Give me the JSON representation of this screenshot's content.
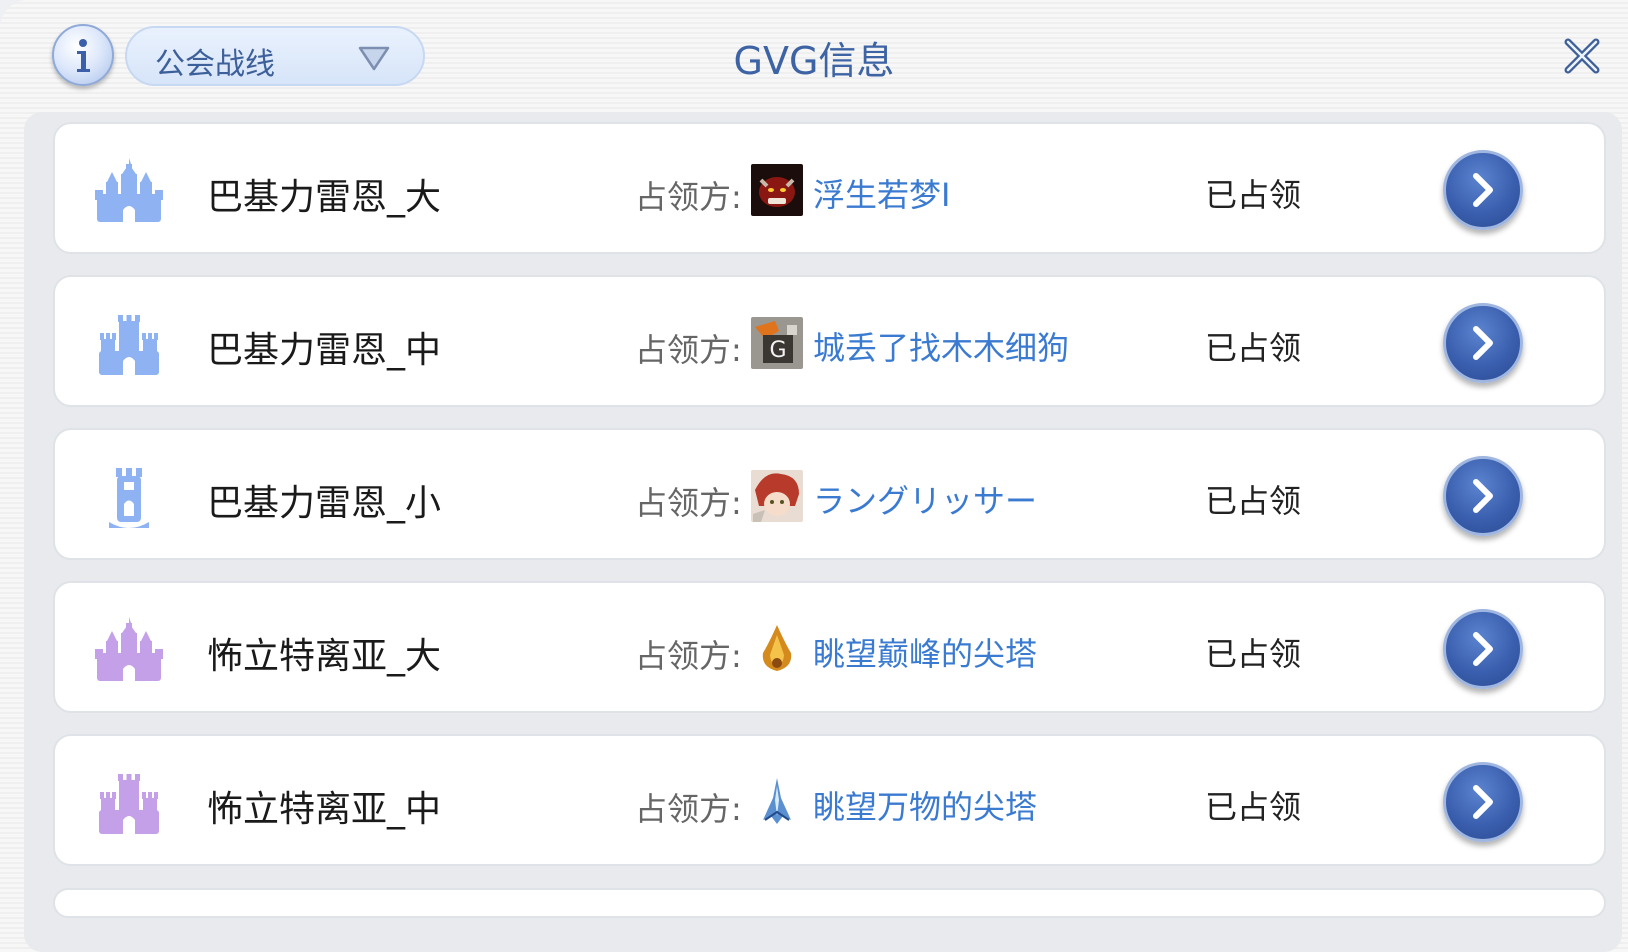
{
  "header": {
    "title": "GVG信息",
    "dropdown_value": "公会战线"
  },
  "owner_label": "占领方:",
  "rows": [
    {
      "castle": "巴基力雷恩_大",
      "guild": "浮生若梦I",
      "status": "已占领"
    },
    {
      "castle": "巴基力雷恩_中",
      "guild": "城丢了找木木细狗",
      "status": "已占领"
    },
    {
      "castle": "巴基力雷恩_小",
      "guild": "ラングリッサー",
      "status": "已占领"
    },
    {
      "castle": "怖立特离亚_大",
      "guild": "眺望巅峰的尖塔",
      "status": "已占领"
    },
    {
      "castle": "怖立特离亚_中",
      "guild": "眺望万物的尖塔",
      "status": "已占领"
    }
  ],
  "colors": {
    "accent": "#3a5fae",
    "guild_link": "#3a7bd1",
    "castle_blue": "#8fb3f2",
    "castle_purple": "#c3a0e8"
  },
  "icons": [
    "info-icon",
    "dropdown-arrow-icon",
    "close-icon",
    "castle-large-icon",
    "castle-medium-icon",
    "castle-small-icon",
    "guild-emblem-icon",
    "chevron-right-icon"
  ]
}
